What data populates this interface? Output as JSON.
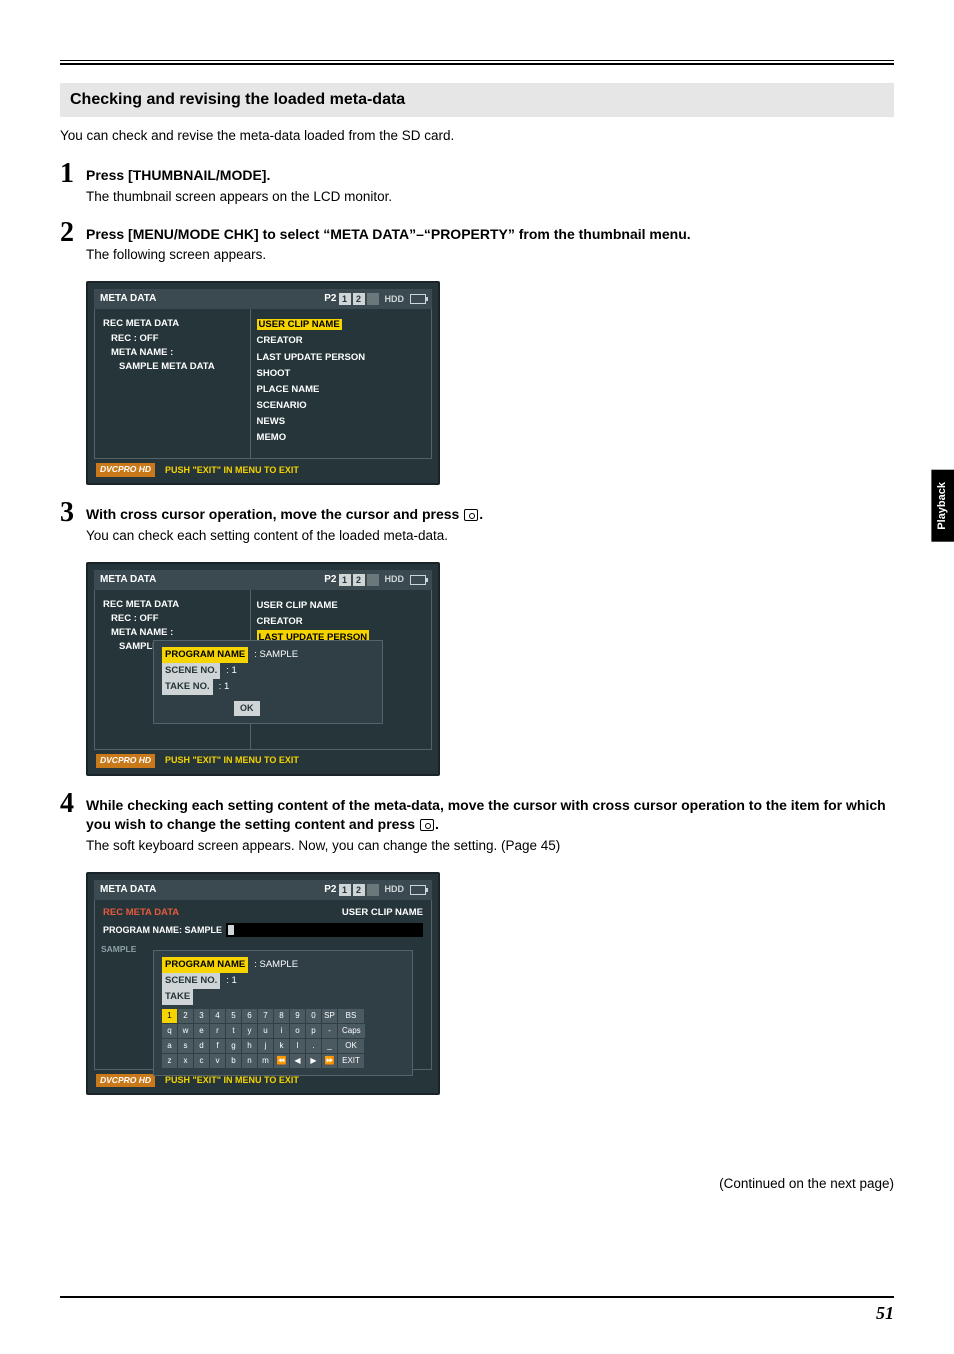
{
  "page": {
    "side_tab": "Playback",
    "number": "51",
    "continued": "(Continued on the next page)"
  },
  "section": {
    "header": "Checking and revising the loaded meta-data",
    "intro": "You can check and revise the meta-data loaded from the SD card."
  },
  "steps": {
    "s1": {
      "num": "1",
      "title": "Press [THUMBNAIL/MODE].",
      "desc": "The thumbnail screen appears on the LCD monitor."
    },
    "s2": {
      "num": "2",
      "title": "Press [MENU/MODE CHK] to select “META DATA”–“PROPERTY” from the thumbnail menu.",
      "desc": "The following screen appears."
    },
    "s3": {
      "num": "3",
      "title_pre": "With cross cursor operation, move the cursor and press ",
      "title_post": ".",
      "desc": "You can check each setting content of the loaded meta-data."
    },
    "s4": {
      "num": "4",
      "title_pre": "While checking each setting content of the meta-data, move the cursor with cross cursor operation to the item for which you wish to change the setting content and press ",
      "title_post": ".",
      "desc": "The soft keyboard screen appears. Now, you can change the setting. (Page 45)"
    }
  },
  "lcd_common": {
    "title": "META DATA",
    "p2": "P2",
    "slot1": "1",
    "slot2": "2",
    "hdd": "HDD",
    "badge": "DVCPRO HD",
    "footer": "PUSH \"EXIT\" IN MENU TO EXIT"
  },
  "lcd1": {
    "left_l1": "REC META DATA",
    "left_l2": "REC : OFF",
    "left_l3": "META NAME :",
    "left_l4": "SAMPLE META DATA",
    "right": {
      "r1": "USER CLIP NAME",
      "r2": "CREATOR",
      "r3": "LAST UPDATE PERSON",
      "r4": "SHOOT",
      "r5": "PLACE NAME",
      "r6": "SCENARIO",
      "r7": "NEWS",
      "r8": "MEMO"
    }
  },
  "lcd2": {
    "left_l1": "REC META DATA",
    "left_l2": "REC : OFF",
    "left_l3": "META NAME :",
    "left_l4": "SAMPLE",
    "right_r1": "USER CLIP NAME",
    "right_r2": "CREATOR",
    "right_r3": "LAST UPDATE PERSON",
    "ov": {
      "program_label": "PROGRAM NAME",
      "program_val": ":  SAMPLE",
      "scene_label": "SCENE NO.",
      "scene_val": ":  1",
      "take_label": "TAKE NO.",
      "take_val": ":  1",
      "ok": "OK"
    }
  },
  "lcd3": {
    "rec": "REC META DATA",
    "ucn": "USER CLIP NAME",
    "pn_label": "PROGRAM NAME: SAMPLE",
    "sample_top": "SAMPLE",
    "ov": {
      "program_label": "PROGRAM NAME",
      "program_val": ":  SAMPLE",
      "scene_label": "SCENE NO.",
      "scene_val": ":  1",
      "take_label": "TAKE"
    },
    "kbd": {
      "r1": [
        "1",
        "2",
        "3",
        "4",
        "5",
        "6",
        "7",
        "8",
        "9",
        "0",
        "SP",
        "BS"
      ],
      "r2": [
        "q",
        "w",
        "e",
        "r",
        "t",
        "y",
        "u",
        "i",
        "o",
        "p",
        "-",
        "Caps"
      ],
      "r3": [
        "a",
        "s",
        "d",
        "f",
        "g",
        "h",
        "j",
        "k",
        "l",
        ".",
        "_",
        "OK"
      ],
      "r4": [
        "z",
        "x",
        "c",
        "v",
        "b",
        "n",
        "m",
        "⏪",
        "◀",
        "▶",
        "⏩",
        "EXIT"
      ]
    }
  }
}
